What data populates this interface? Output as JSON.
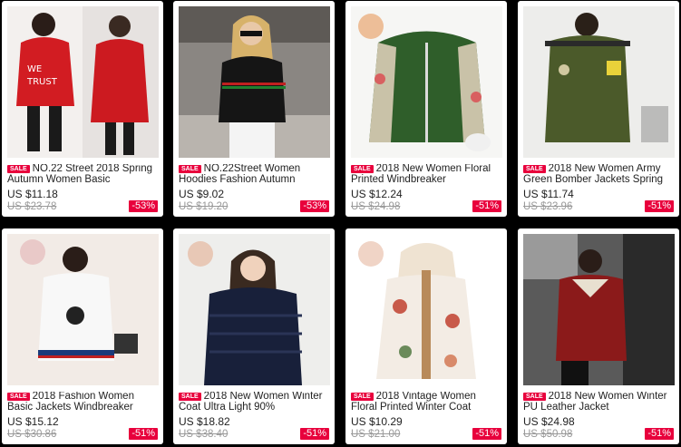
{
  "products": [
    {
      "sale": "SALE",
      "title": "NO.22 Street 2018 Spring Autumn Women Basic",
      "price": "US $11.18",
      "old": "US $23.78",
      "discount": "-53%",
      "img": "red-hoodie"
    },
    {
      "sale": "SALE",
      "title": "NO.22Street Women Hoodies Fashion Autumn",
      "price": "US $9.02",
      "old": "US $19.20",
      "discount": "-53%",
      "img": "black-sweater"
    },
    {
      "sale": "SALE",
      "title": "2018 New Women Floral Printed Windbreaker",
      "price": "US $12.24",
      "old": "US $24.98",
      "discount": "-51%",
      "img": "green-floral-jacket"
    },
    {
      "sale": "SALE",
      "title": "2018 New Women Army Green Bomber Jackets Spring",
      "price": "US $11.74",
      "old": "US $23.96",
      "discount": "-51%",
      "img": "army-bomber"
    },
    {
      "sale": "SALE",
      "title": "2018 Fashion Women Basic Jackets Windbreaker",
      "price": "US $15.12",
      "old": "US $30.86",
      "discount": "-51%",
      "img": "white-jacket"
    },
    {
      "sale": "SALE",
      "title": "2018 New Women Winter Coat Ultra Light 90%",
      "price": "US $18.82",
      "old": "US $38.40",
      "discount": "-51%",
      "img": "navy-puffer"
    },
    {
      "sale": "SALE",
      "title": "2018 Vintage Women Floral Printed Winter Coat",
      "price": "US $10.29",
      "old": "US $21.00",
      "discount": "-51%",
      "img": "floral-coat"
    },
    {
      "sale": "SALE",
      "title": "2018 New Women Winter PU Leather Jacket",
      "price": "US $24.98",
      "old": "US $50.98",
      "discount": "-51%",
      "img": "red-leather"
    }
  ],
  "colors": {
    "accent": "#e8003c",
    "background": "#000000"
  }
}
